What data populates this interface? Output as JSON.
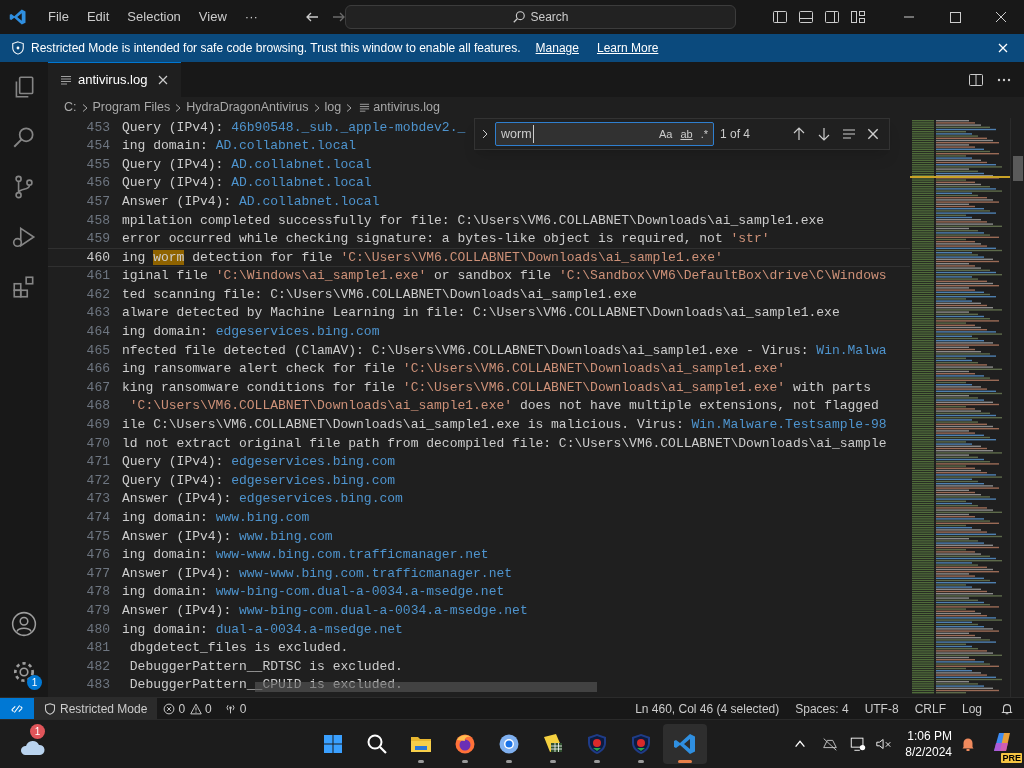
{
  "title_bar": {
    "menu": [
      "File",
      "Edit",
      "Selection",
      "View",
      "···"
    ],
    "search": "Search"
  },
  "banner": {
    "message": "Restricted Mode is intended for safe code browsing. Trust this window to enable all features.",
    "links": [
      "Manage",
      "Learn More"
    ]
  },
  "activity_bar": {
    "items": [
      {
        "kind": "files"
      },
      {
        "kind": "search"
      },
      {
        "kind": "source-control"
      },
      {
        "kind": "run"
      },
      {
        "kind": "extensions"
      }
    ],
    "settings_badge": "1"
  },
  "tabs": [
    {
      "label": "antivirus.log",
      "selected": true
    }
  ],
  "breadcrumb": [
    "C:",
    "Program Files",
    "HydraDragonAntivirus",
    "log",
    "antivirus.log"
  ],
  "editor": {
    "lines": [
      {
        "number": "453",
        "current": false,
        "segments": [
          {
            "kind": "plain",
            "text": "Query (IPv4): "
          },
          {
            "kind": "link",
            "text": "46b90548._sub._apple-mobdev2._"
          }
        ]
      },
      {
        "number": "454",
        "current": false,
        "segments": [
          {
            "kind": "plain",
            "text": "ing domain: "
          },
          {
            "kind": "link",
            "text": "AD.collabnet.local"
          }
        ]
      },
      {
        "number": "455",
        "current": false,
        "segments": [
          {
            "kind": "plain",
            "text": "Query (IPv4): "
          },
          {
            "kind": "link",
            "text": "AD.collabnet.local"
          }
        ]
      },
      {
        "number": "456",
        "current": false,
        "segments": [
          {
            "kind": "plain",
            "text": "Query (IPv4): "
          },
          {
            "kind": "link",
            "text": "AD.collabnet.local"
          }
        ]
      },
      {
        "number": "457",
        "current": false,
        "segments": [
          {
            "kind": "plain",
            "text": "Answer (IPv4): "
          },
          {
            "kind": "link",
            "text": "AD.collabnet.local"
          }
        ]
      },
      {
        "number": "458",
        "current": false,
        "segments": [
          {
            "kind": "plain",
            "text": "mpilation completed successfully for file: C:\\Users\\VM6.COLLABNET\\Downloads\\ai_sample1.exe"
          }
        ]
      },
      {
        "number": "459",
        "current": false,
        "segments": [
          {
            "kind": "plain",
            "text": "error occurred while checking signature: a bytes-like object is required, not "
          },
          {
            "kind": "string",
            "text": "'str'"
          }
        ]
      },
      {
        "number": "460",
        "current": true,
        "segments": [
          {
            "kind": "plain",
            "text": "ing "
          },
          {
            "kind": "match",
            "text": "worm"
          },
          {
            "kind": "plain",
            "text": " detection for file "
          },
          {
            "kind": "string",
            "text": "'C:\\Users\\VM6.COLLABNET\\Downloads\\ai_sample1.exe'"
          }
        ]
      },
      {
        "number": "461",
        "current": false,
        "segments": [
          {
            "kind": "plain",
            "text": "iginal file "
          },
          {
            "kind": "string",
            "text": "'C:\\Windows\\ai_sample1.exe'"
          },
          {
            "kind": "plain",
            "text": " or sandbox file "
          },
          {
            "kind": "string",
            "text": "'C:\\Sandbox\\VM6\\DefaultBox\\drive\\C\\Windows"
          }
        ]
      },
      {
        "number": "462",
        "current": false,
        "segments": [
          {
            "kind": "plain",
            "text": "ted scanning file: C:\\Users\\VM6.COLLABNET\\Downloads\\ai_sample1.exe"
          }
        ]
      },
      {
        "number": "463",
        "current": false,
        "segments": [
          {
            "kind": "plain",
            "text": "alware detected by Machine Learning in file: C:\\Users\\VM6.COLLABNET\\Downloads\\ai_sample1.exe"
          }
        ]
      },
      {
        "number": "464",
        "current": false,
        "segments": [
          {
            "kind": "plain",
            "text": "ing domain: "
          },
          {
            "kind": "link",
            "text": "edgeservices.bing.com"
          }
        ]
      },
      {
        "number": "465",
        "current": false,
        "segments": [
          {
            "kind": "plain",
            "text": "nfected file detected (ClamAV): C:\\Users\\VM6.COLLABNET\\Downloads\\ai_sample1.exe - Virus: "
          },
          {
            "kind": "link",
            "text": "Win.Malwa"
          }
        ]
      },
      {
        "number": "466",
        "current": false,
        "segments": [
          {
            "kind": "plain",
            "text": "ing ransomware alert check for file "
          },
          {
            "kind": "string",
            "text": "'C:\\Users\\VM6.COLLABNET\\Downloads\\ai_sample1.exe'"
          }
        ]
      },
      {
        "number": "467",
        "current": false,
        "segments": [
          {
            "kind": "plain",
            "text": "king ransomware conditions for file "
          },
          {
            "kind": "string",
            "text": "'C:\\Users\\VM6.COLLABNET\\Downloads\\ai_sample1.exe'"
          },
          {
            "kind": "plain",
            "text": " with parts"
          }
        ]
      },
      {
        "number": "468",
        "current": false,
        "segments": [
          {
            "kind": "string",
            "text": " 'C:\\Users\\VM6.COLLABNET\\Downloads\\ai_sample1.exe'"
          },
          {
            "kind": "plain",
            "text": " does not have multiple extensions, not flagged"
          }
        ]
      },
      {
        "number": "469",
        "current": false,
        "segments": [
          {
            "kind": "plain",
            "text": "ile C:\\Users\\VM6.COLLABNET\\Downloads\\ai_sample1.exe is malicious. Virus: "
          },
          {
            "kind": "link",
            "text": "Win.Malware.Testsample-98"
          }
        ]
      },
      {
        "number": "470",
        "current": false,
        "segments": [
          {
            "kind": "plain",
            "text": "ld not extract original file path from decompiled file: C:\\Users\\VM6.COLLABNET\\Downloads\\ai_sample"
          }
        ]
      },
      {
        "number": "471",
        "current": false,
        "segments": [
          {
            "kind": "plain",
            "text": "Query (IPv4): "
          },
          {
            "kind": "link",
            "text": "edgeservices.bing.com"
          }
        ]
      },
      {
        "number": "472",
        "current": false,
        "segments": [
          {
            "kind": "plain",
            "text": "Query (IPv4): "
          },
          {
            "kind": "link",
            "text": "edgeservices.bing.com"
          }
        ]
      },
      {
        "number": "473",
        "current": false,
        "segments": [
          {
            "kind": "plain",
            "text": "Answer (IPv4): "
          },
          {
            "kind": "link",
            "text": "edgeservices.bing.com"
          }
        ]
      },
      {
        "number": "474",
        "current": false,
        "segments": [
          {
            "kind": "plain",
            "text": "ing domain: "
          },
          {
            "kind": "link",
            "text": "www.bing.com"
          }
        ]
      },
      {
        "number": "475",
        "current": false,
        "segments": [
          {
            "kind": "plain",
            "text": "Answer (IPv4): "
          },
          {
            "kind": "link",
            "text": "www.bing.com"
          }
        ]
      },
      {
        "number": "476",
        "current": false,
        "segments": [
          {
            "kind": "plain",
            "text": "ing domain: "
          },
          {
            "kind": "link",
            "text": "www-www.bing.com.trafficmanager.net"
          }
        ]
      },
      {
        "number": "477",
        "current": false,
        "segments": [
          {
            "kind": "plain",
            "text": "Answer (IPv4): "
          },
          {
            "kind": "link",
            "text": "www-www.bing.com.trafficmanager.net"
          }
        ]
      },
      {
        "number": "478",
        "current": false,
        "segments": [
          {
            "kind": "plain",
            "text": "ing domain: "
          },
          {
            "kind": "link",
            "text": "www-bing-com.dual-a-0034.a-msedge.net"
          }
        ]
      },
      {
        "number": "479",
        "current": false,
        "segments": [
          {
            "kind": "plain",
            "text": "Answer (IPv4): "
          },
          {
            "kind": "link",
            "text": "www-bing-com.dual-a-0034.a-msedge.net"
          }
        ]
      },
      {
        "number": "480",
        "current": false,
        "segments": [
          {
            "kind": "plain",
            "text": "ing domain: "
          },
          {
            "kind": "link",
            "text": "dual-a-0034.a-msedge.net"
          }
        ]
      },
      {
        "number": "481",
        "current": false,
        "segments": [
          {
            "kind": "plain",
            "text": " dbgdetect_files is excluded."
          }
        ]
      },
      {
        "number": "482",
        "current": false,
        "segments": [
          {
            "kind": "plain",
            "text": " DebuggerPattern__RDTSC is excluded."
          }
        ]
      },
      {
        "number": "483",
        "current": false,
        "segments": [
          {
            "kind": "plain",
            "text": " DebuggerPattern__CPUID is excluded."
          }
        ]
      }
    ]
  },
  "find": {
    "value": "worm",
    "options": [
      {
        "label": "Aa",
        "on": false
      },
      {
        "label": "ab",
        "on": false
      },
      {
        "label": ".*",
        "on": false
      }
    ],
    "count": "1 of 4"
  },
  "status_bar": {
    "mode": "Restricted Mode",
    "errors": "0",
    "warnings": "0",
    "ports": "0",
    "right": [
      "Ln 460, Col 46 (4 selected)",
      "Spaces: 4",
      "UTF-8",
      "CRLF",
      "Log"
    ]
  },
  "taskbar": {
    "weather_badge": "1",
    "apps": [
      {
        "kind": "start",
        "running": false,
        "selected": false
      },
      {
        "kind": "search",
        "running": false,
        "selected": false
      },
      {
        "kind": "folder",
        "running": true,
        "selected": false
      },
      {
        "kind": "firefox",
        "running": true,
        "selected": false
      },
      {
        "kind": "chrome",
        "running": true,
        "selected": false
      },
      {
        "kind": "table",
        "running": true,
        "selected": false
      },
      {
        "kind": "shield",
        "running": true,
        "selected": false
      },
      {
        "kind": "shield",
        "running": true,
        "selected": false
      },
      {
        "kind": "vscode",
        "running": true,
        "selected": true
      }
    ],
    "time": "1:06 PM",
    "date": "8/2/2024",
    "copilot_label": "PRE"
  }
}
